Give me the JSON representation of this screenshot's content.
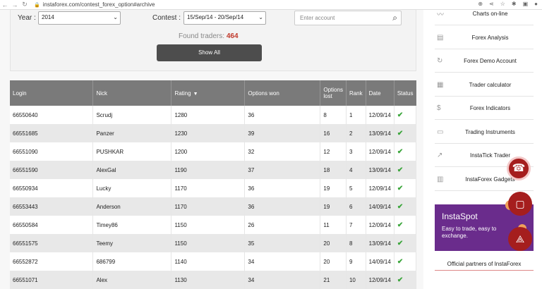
{
  "browser": {
    "url": "instaforex.com/contest_forex_option#archive"
  },
  "filters": {
    "year_label": "Year :",
    "year_value": "2014",
    "contest_label": "Contest :",
    "contest_value": "15/Sep/14 - 20/Sep/14",
    "search_placeholder": "Enter account",
    "found_label": "Found traders:",
    "found_count": "464",
    "show_all": "Show All"
  },
  "table": {
    "headers": [
      "Login",
      "Nick",
      "Rating",
      "Options won",
      "Options lost",
      "Rank",
      "Date",
      "Status"
    ],
    "rows": [
      [
        "66550640",
        "Scrudj",
        "1280",
        "36",
        "8",
        "1",
        "12/09/14"
      ],
      [
        "66551685",
        "Panzer",
        "1230",
        "39",
        "16",
        "2",
        "13/09/14"
      ],
      [
        "66551090",
        "PUSHKAR",
        "1200",
        "32",
        "12",
        "3",
        "12/09/14"
      ],
      [
        "66551590",
        "AlexGal",
        "1190",
        "37",
        "18",
        "4",
        "13/09/14"
      ],
      [
        "66550934",
        "Lucky",
        "1170",
        "36",
        "19",
        "5",
        "12/09/14"
      ],
      [
        "66553443",
        "Anderson",
        "1170",
        "36",
        "19",
        "6",
        "14/09/14"
      ],
      [
        "66550584",
        "Timey86",
        "1150",
        "26",
        "11",
        "7",
        "12/09/14"
      ],
      [
        "66551575",
        "Teemy",
        "1150",
        "35",
        "20",
        "8",
        "13/09/14"
      ],
      [
        "66552872",
        "686799",
        "1140",
        "34",
        "20",
        "9",
        "14/09/14"
      ],
      [
        "66551071",
        "Alex",
        "1130",
        "34",
        "21",
        "10",
        "12/09/14"
      ]
    ]
  },
  "sidebar": {
    "items": [
      "Charts on-line",
      "Forex Analysis",
      "Forex Demo Account",
      "Trader calculator",
      "Forex Indicators",
      "Trading Instruments",
      "InstaTick Trader",
      "InstaForex Gadgets"
    ],
    "promo_title": "InstaSpot",
    "promo_text": "Easy to trade, easy to exchange.",
    "partners": "Official partners of InstaForex"
  },
  "colors": {
    "accent": "#c0392b",
    "promo": "#6a2c8c",
    "fab": "#a51e1e"
  }
}
